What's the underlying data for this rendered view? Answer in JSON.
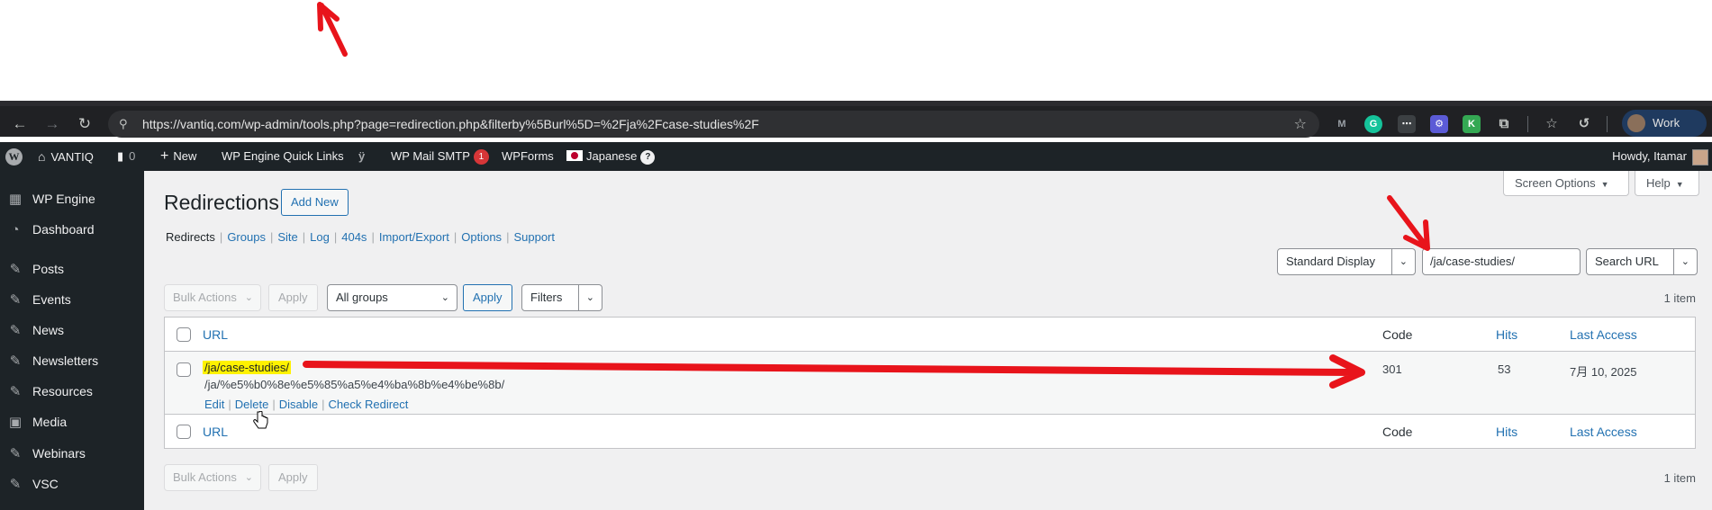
{
  "browser": {
    "url": "https://vantiq.com/wp-admin/tools.php?page=redirection.php&filterby%5Burl%5D=%2Fja%2Fcase-studies%2F",
    "profile_label": "Work",
    "icons": [
      "back-icon",
      "forward-icon",
      "reload-icon",
      "site-info-icon",
      "bookmark-star-icon"
    ],
    "extensions": [
      {
        "name": "m-extension-icon",
        "color": "#9aa0a6",
        "glyph": "M"
      },
      {
        "name": "grammarly-icon",
        "color": "#15c39a",
        "glyph": "G"
      },
      {
        "name": "dots-extension-icon",
        "color": "#5f6368",
        "glyph": "⋯"
      },
      {
        "name": "gear-extension-icon",
        "color": "#5b5bd6",
        "glyph": "⚙"
      },
      {
        "name": "k-extension-icon",
        "color": "#34a853",
        "glyph": "K"
      },
      {
        "name": "puzzle-icon",
        "color": "#202124",
        "glyph": "⧉"
      }
    ]
  },
  "adminbar": {
    "site_name": "VANTIQ",
    "comments_count": "0",
    "new_label": "New",
    "quick_links": "WP Engine Quick Links",
    "mail_smtp": "WP Mail SMTP",
    "mail_smtp_badge": "1",
    "wpforms": "WPForms",
    "language": "Japanese",
    "language_badge": "?",
    "howdy": "Howdy, Itamar"
  },
  "sidebar": {
    "items": [
      {
        "label": "WP Engine",
        "icon": "grid-icon"
      },
      {
        "label": "Dashboard",
        "icon": "dashboard-icon"
      },
      {
        "label": "Posts",
        "icon": "pin-icon"
      },
      {
        "label": "Events",
        "icon": "pin-icon"
      },
      {
        "label": "News",
        "icon": "pin-icon"
      },
      {
        "label": "Newsletters",
        "icon": "pin-icon"
      },
      {
        "label": "Resources",
        "icon": "pin-icon"
      },
      {
        "label": "Media",
        "icon": "media-icon"
      },
      {
        "label": "Webinars",
        "icon": "pin-icon"
      },
      {
        "label": "VSC",
        "icon": "pin-icon"
      }
    ]
  },
  "screen_options": "Screen Options",
  "help": "Help",
  "page": {
    "title": "Redirections",
    "add_new": "Add New"
  },
  "subnav": {
    "current": "Redirects",
    "links": [
      "Groups",
      "Site",
      "Log",
      "404s",
      "Import/Export",
      "Options",
      "Support"
    ]
  },
  "search": {
    "display_mode": "Standard Display",
    "query": "/ja/case-studies/",
    "search_button": "Search URL"
  },
  "toolbar": {
    "bulk_actions": "Bulk Actions",
    "apply": "Apply",
    "groups_select": "All groups",
    "groups_apply": "Apply",
    "filters": "Filters",
    "item_count": "1 item"
  },
  "table": {
    "columns": {
      "url": "URL",
      "code": "Code",
      "hits": "Hits",
      "last_access": "Last Access"
    },
    "rows": [
      {
        "source": "/ja/case-studies/",
        "target": "/ja/%e5%b0%8e%e5%85%a5%e4%ba%8b%e4%be%8b/",
        "code": "301",
        "hits": "53",
        "last_access": "7月 10, 2025",
        "actions": [
          "Edit",
          "Delete",
          "Disable",
          "Check Redirect"
        ]
      }
    ]
  },
  "annotation_color": "#e8141b"
}
